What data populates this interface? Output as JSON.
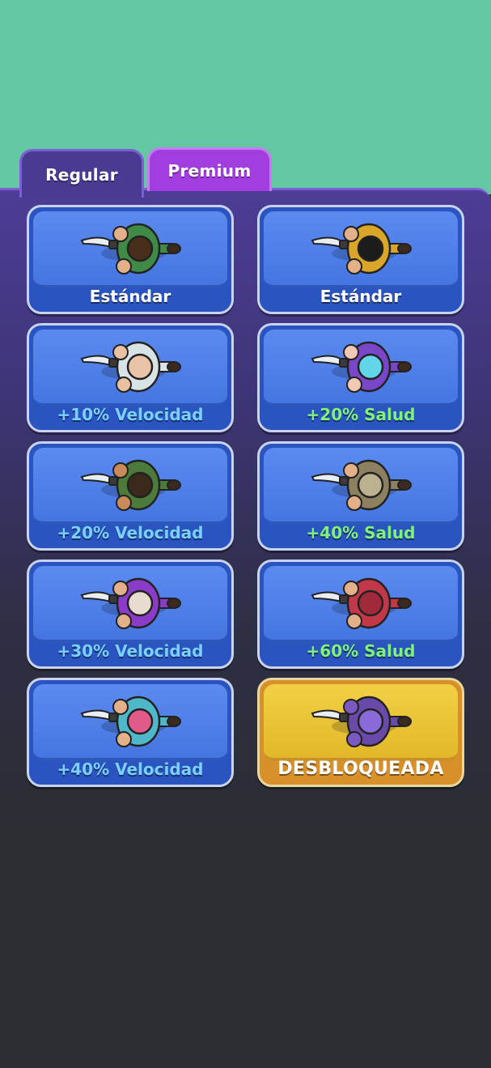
{
  "tabs": [
    {
      "label": "Regular",
      "active": true
    },
    {
      "label": "Premium",
      "active": false
    }
  ],
  "skins": [
    {
      "label": "Estándar",
      "label_color": "#ffffff",
      "character": "green-vest-knife-character-icon",
      "outfit": "#3f8a47",
      "hair": "#4a2e1c",
      "skin": "#e4b08a",
      "unlocked": false
    },
    {
      "label": "Estándar",
      "label_color": "#ffffff",
      "character": "yellow-jacket-knife-character-icon",
      "outfit": "#d9a62a",
      "hair": "#1c1c1c",
      "skin": "#e4b08a",
      "unlocked": false
    },
    {
      "label": "+10% Velocidad",
      "label_color": "#7ad0ff",
      "character": "bald-elder-knife-character-icon",
      "outfit": "#d8e3e6",
      "hair": "#e9c4a8",
      "skin": "#e8c1a2",
      "unlocked": false
    },
    {
      "label": "+20% Salud",
      "label_color": "#7ff27a",
      "character": "cyan-hair-knife-character-icon",
      "outfit": "#7a46c8",
      "hair": "#62d6e8",
      "skin": "#f0c8b4",
      "unlocked": false
    },
    {
      "label": "+20% Velocidad",
      "label_color": "#7ad0ff",
      "character": "muscle-brawler-knife-character-icon",
      "outfit": "#4b7a3a",
      "hair": "#3b2a1c",
      "skin": "#c98a5a",
      "unlocked": false
    },
    {
      "label": "+40% Salud",
      "label_color": "#7ff27a",
      "character": "safari-hat-knife-character-icon",
      "outfit": "#8c8060",
      "hair": "#bcb290",
      "skin": "#e4b08a",
      "unlocked": false
    },
    {
      "label": "+30% Velocidad",
      "label_color": "#7ad0ff",
      "character": "purple-wizard-knife-character-icon",
      "outfit": "#8a3cc8",
      "hair": "#e8dcd0",
      "skin": "#e4b08a",
      "unlocked": false
    },
    {
      "label": "+60% Salud",
      "label_color": "#7ff27a",
      "character": "red-hoodie-knife-character-icon",
      "outfit": "#c23848",
      "hair": "#a12a3a",
      "skin": "#e4b08a",
      "unlocked": false
    },
    {
      "label": "+40% Velocidad",
      "label_color": "#7ad0ff",
      "character": "pinata-costume-knife-character-icon",
      "outfit": "#4fb8c8",
      "hair": "#e05a8a",
      "skin": "#e4b08a",
      "unlocked": false
    },
    {
      "label": "DESBLOQUEADA",
      "label_color": "#ffffff",
      "character": "oni-mask-knife-character-icon",
      "outfit": "#6a4aa8",
      "hair": "#8a6ad8",
      "skin": "#7a5ac0",
      "unlocked": true
    }
  ],
  "colors": {
    "background_top": "#62c7a2",
    "panel": "#4e3c96",
    "card": "#4575e0",
    "card_gold": "#e2b828",
    "speed_text": "#7ad0ff",
    "health_text": "#7ff27a"
  }
}
